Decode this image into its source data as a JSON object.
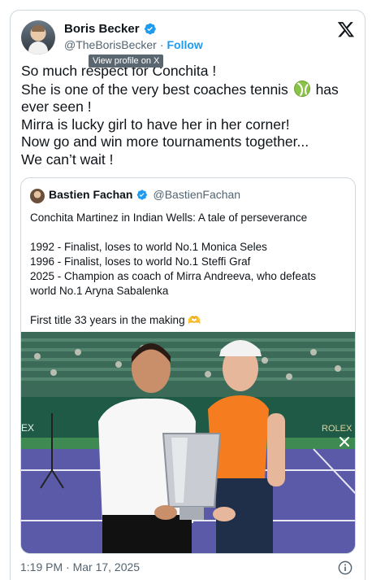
{
  "author": {
    "name": "Boris Becker",
    "handle": "@TheBorisBecker",
    "separator": "·",
    "follow_label": "Follow",
    "tooltip": "View profile on X"
  },
  "tweet": {
    "lines": [
      "So much respect for Conchita !",
      "She is one of the very best coaches tennis",
      "has",
      "ever seen !",
      "Mirra is lucky girl to have her in her corner!",
      "Now go and win more tournaments together...",
      "We can’t wait !"
    ]
  },
  "quote": {
    "name": "Bastien Fachan",
    "handle": "@BastienFachan",
    "lines": [
      "Conchita Martinez in Indian Wells: A tale of perseverance",
      "",
      "1992 - Finalist, loses to world No.1 Monica Seles",
      "1996 - Finalist, loses to world No.1 Steffi Graf",
      "2025 - Champion as coach of Mirra Andreeva, who defeats",
      "world No.1 Aryna Sabalenka",
      "",
      "First title 33 years in the making"
    ],
    "banner_text": "EX",
    "banner_text_right": "ROLEX"
  },
  "footer": {
    "timestamp": "1:19 PM · Mar 17, 2025"
  },
  "colors": {
    "accent": "#1d9bf0",
    "text": "#0f1419",
    "muted": "#536471",
    "border": "#cfd9de"
  },
  "icons": {
    "verified": "verified-badge-icon",
    "x_logo": "x-logo-icon",
    "tennis_ball": "tennis-ball-icon",
    "heart_hands": "heart-hands-icon",
    "info": "info-icon",
    "close": "close-icon"
  }
}
